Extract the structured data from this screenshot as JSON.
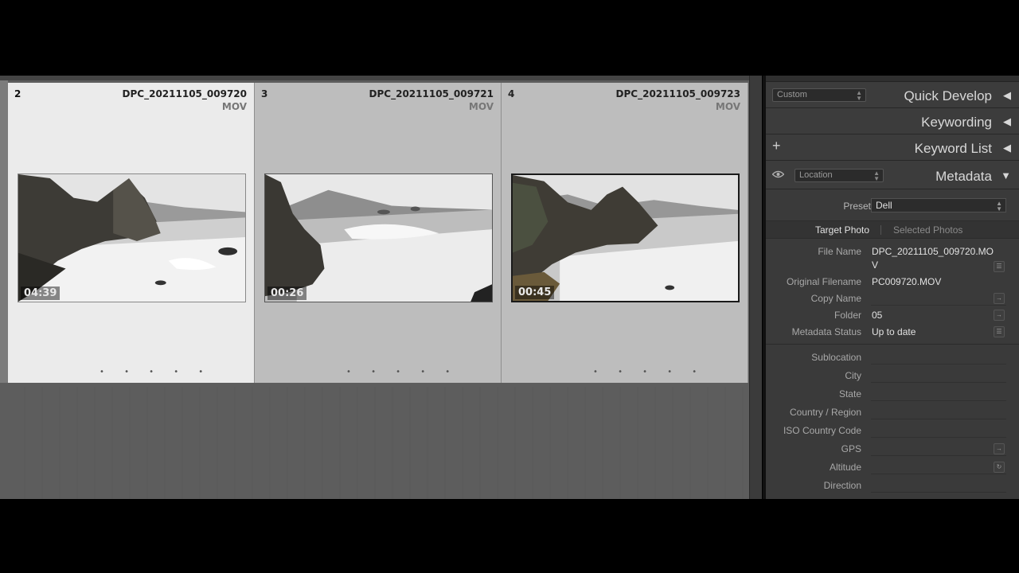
{
  "grid": {
    "cells": [
      {
        "index": "2",
        "name": "DPC_20211105_009720",
        "ext": "MOV",
        "duration": "04:39",
        "selected": true
      },
      {
        "index": "3",
        "name": "DPC_20211105_009721",
        "ext": "MOV",
        "duration": "00:26",
        "selected": false
      },
      {
        "index": "4",
        "name": "DPC_20211105_009723",
        "ext": "MOV",
        "duration": "00:45",
        "selected": false
      }
    ],
    "dots": "• • • • •"
  },
  "panel": {
    "quick_develop": {
      "title": "Quick Develop",
      "preset": "Custom"
    },
    "keywording": {
      "title": "Keywording"
    },
    "keyword_list": {
      "title": "Keyword List",
      "add": "+"
    },
    "metadata": {
      "title": "Metadata",
      "view": "Location",
      "preset_label": "Preset",
      "preset_value": "Dell",
      "tab_target": "Target Photo",
      "tab_selected": "Selected Photos",
      "fields": [
        {
          "label": "File Name",
          "value": "DPC_20211105_009720.MO"
        },
        {
          "label": "Original Filename",
          "value": "PC009720.MOV"
        },
        {
          "label": "Copy Name",
          "value": ""
        },
        {
          "label": "Folder",
          "value": "05"
        },
        {
          "label": "Metadata Status",
          "value": "Up to date"
        }
      ],
      "file_name_wrap": "V",
      "location_fields": [
        {
          "label": "Sublocation",
          "value": ""
        },
        {
          "label": "City",
          "value": ""
        },
        {
          "label": "State",
          "value": ""
        },
        {
          "label": "Country / Region",
          "value": ""
        },
        {
          "label": "ISO Country Code",
          "value": ""
        },
        {
          "label": "GPS",
          "value": ""
        },
        {
          "label": "Altitude",
          "value": ""
        },
        {
          "label": "Direction",
          "value": ""
        }
      ]
    }
  },
  "icons": {
    "collapse": "triangle-left-icon",
    "expand": "triangle-down-icon",
    "eye": "eye-icon"
  }
}
